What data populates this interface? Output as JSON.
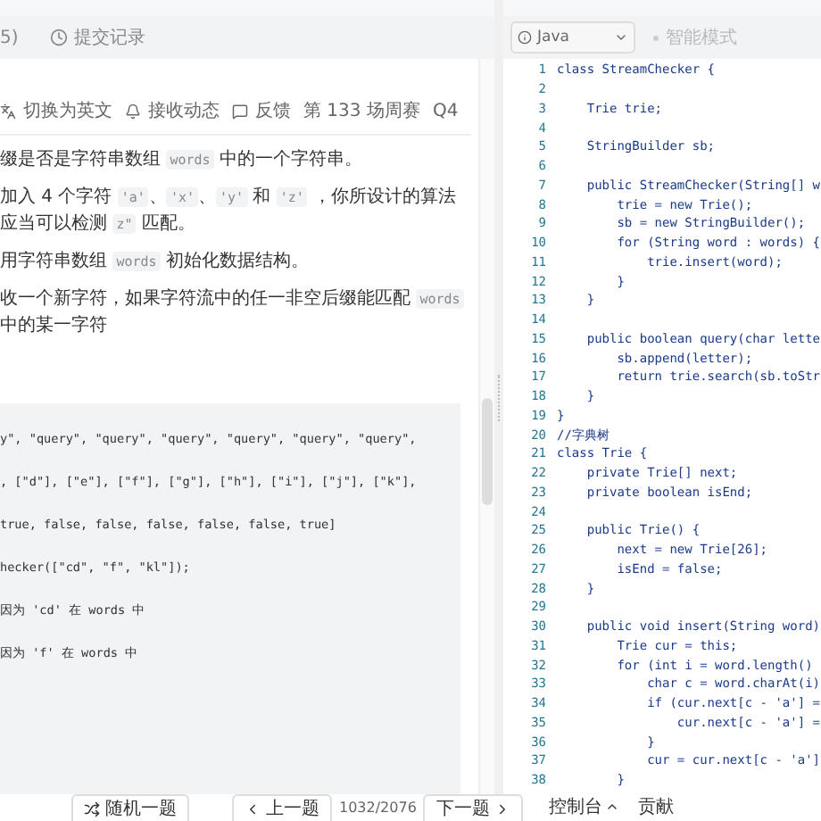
{
  "left_tabs": [
    {
      "kind": "plain",
      "label": "5)"
    },
    {
      "kind": "history",
      "label": "提交记录"
    }
  ],
  "toolbar": [
    {
      "kind": "translate",
      "label": "切换为英文"
    },
    {
      "kind": "bell",
      "label": "接收动态"
    },
    {
      "kind": "feedback",
      "label": "反馈"
    },
    {
      "kind": "text",
      "label": "第 133 场周赛"
    },
    {
      "kind": "text",
      "label": "Q4"
    }
  ],
  "description": [
    [
      {
        "kind": "text",
        "text": "缀是否是字符串数组 "
      },
      {
        "kind": "code",
        "text": "words"
      },
      {
        "kind": "text",
        "text": " 中的一个字符串。"
      }
    ],
    [
      {
        "kind": "text",
        "text": "加入 4 个字符 "
      },
      {
        "kind": "code",
        "text": "'a'"
      },
      {
        "kind": "text",
        "text": "、"
      },
      {
        "kind": "code",
        "text": "'x'"
      },
      {
        "kind": "text",
        "text": "、"
      },
      {
        "kind": "code",
        "text": "'y'"
      },
      {
        "kind": "text",
        "text": " 和 "
      },
      {
        "kind": "code",
        "text": "'z'"
      },
      {
        "kind": "text",
        "text": " ，你所设计的算法应当可以检测 "
      },
      {
        "kind": "code",
        "text": "z\""
      },
      {
        "kind": "text",
        "text": " 匹配。"
      }
    ],
    [
      {
        "kind": "text",
        "text": "用字符串数组 "
      },
      {
        "kind": "code",
        "text": "words"
      },
      {
        "kind": "text",
        "text": " 初始化数据结构。"
      }
    ],
    [
      {
        "kind": "text",
        "text": "收一个新字符，如果字符流中的任一非空后缀能匹配 "
      },
      {
        "kind": "code",
        "text": "words"
      },
      {
        "kind": "text",
        "text": " 中的某一字符"
      }
    ]
  ],
  "example_lines": [
    "y\", \"query\", \"query\", \"query\", \"query\", \"query\", \"query\",",
    ", [\"d\"], [\"e\"], [\"f\"], [\"g\"], [\"h\"], [\"i\"], [\"j\"], [\"k\"],",
    "true, false, false, false, false, false, true]",
    "hecker([\"cd\", \"f\", \"kl\"]);",
    "因为 'cd' 在 words 中",
    "因为 'f' 在 words 中"
  ],
  "editor": {
    "language": "Java",
    "mode": "智能模式",
    "lines": [
      {
        "number": "1",
        "code": "class StreamChecker {"
      },
      {
        "number": "2"
      },
      {
        "number": "3",
        "code": "    Trie trie;"
      },
      {
        "number": "4"
      },
      {
        "number": "5",
        "code": "    StringBuilder sb;"
      },
      {
        "number": "6"
      },
      {
        "number": "7",
        "code": "    public StreamChecker(String[] w"
      },
      {
        "number": "8",
        "code": "        trie = new Trie();"
      },
      {
        "number": "9",
        "code": "        sb = new StringBuilder();"
      },
      {
        "number": "10",
        "code": "        for (String word : words) {"
      },
      {
        "number": "11",
        "code": "            trie.insert(word);"
      },
      {
        "number": "12",
        "code": "        }"
      },
      {
        "number": "13",
        "code": "    }"
      },
      {
        "number": "14"
      },
      {
        "number": "15",
        "code": "    public boolean query(char lette"
      },
      {
        "number": "16",
        "code": "        sb.append(letter);"
      },
      {
        "number": "17",
        "code": "        return trie.search(sb.toStr"
      },
      {
        "number": "18",
        "code": "    }"
      },
      {
        "number": "19",
        "code": "}"
      },
      {
        "number": "20",
        "code": "//字典树"
      },
      {
        "number": "21",
        "code": "class Trie {"
      },
      {
        "number": "22",
        "code": "    private Trie[] next;"
      },
      {
        "number": "23",
        "code": "    private boolean isEnd;"
      },
      {
        "number": "24"
      },
      {
        "number": "25",
        "code": "    public Trie() {"
      },
      {
        "number": "26",
        "code": "        next = new Trie[26];"
      },
      {
        "number": "27",
        "code": "        isEnd = false;"
      },
      {
        "number": "28",
        "code": "    }"
      },
      {
        "number": "29"
      },
      {
        "number": "30",
        "code": "    public void insert(String word)"
      },
      {
        "number": "31",
        "code": "        Trie cur = this;"
      },
      {
        "number": "32",
        "code": "        for (int i = word.length()"
      },
      {
        "number": "33",
        "code": "            char c = word.charAt(i)"
      },
      {
        "number": "34",
        "code": "            if (cur.next[c - 'a'] ="
      },
      {
        "number": "35",
        "code": "                cur.next[c - 'a'] ="
      },
      {
        "number": "36",
        "code": "            }"
      },
      {
        "number": "37",
        "code": "            cur = cur.next[c - 'a']"
      },
      {
        "number": "38",
        "code": "        }"
      }
    ]
  },
  "bottom_bar": {
    "random": "随机一题",
    "prev": "上一题",
    "counter": "1032/2076",
    "next": "下一题",
    "console": "控制台",
    "contribute": "贡献"
  }
}
